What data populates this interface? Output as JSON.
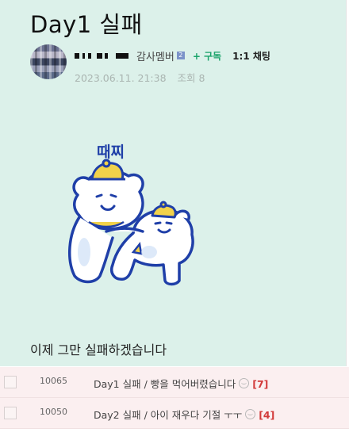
{
  "post": {
    "title": "Day1 실패",
    "author": {
      "grade": "감사멤버",
      "grade_badge": "2",
      "subscribe_label": "+ 구독",
      "chat_label": "1:1 채팅"
    },
    "date": "2023.06.11. 21:38",
    "views_label": "조회 8",
    "sticker_text": "때찌",
    "body": "이제 그만 실패하겠습니다"
  },
  "list": {
    "rows": [
      {
        "num": "10065",
        "subject": "Day1 실패 / 빵을 먹어버렸습니다",
        "comments": "[7]"
      },
      {
        "num": "10050",
        "subject": "Day2 실패 / 아이 재우다 기절 ㅜㅜ",
        "comments": "[4]"
      }
    ]
  },
  "colors": {
    "post_bg": "#dcf1ea",
    "list_bg": "#fbeff0",
    "subscribe": "#1aa36a",
    "comment_count": "#d23a3a",
    "sticker_line": "#1f3fa8",
    "sticker_accent": "#f2d24a"
  }
}
